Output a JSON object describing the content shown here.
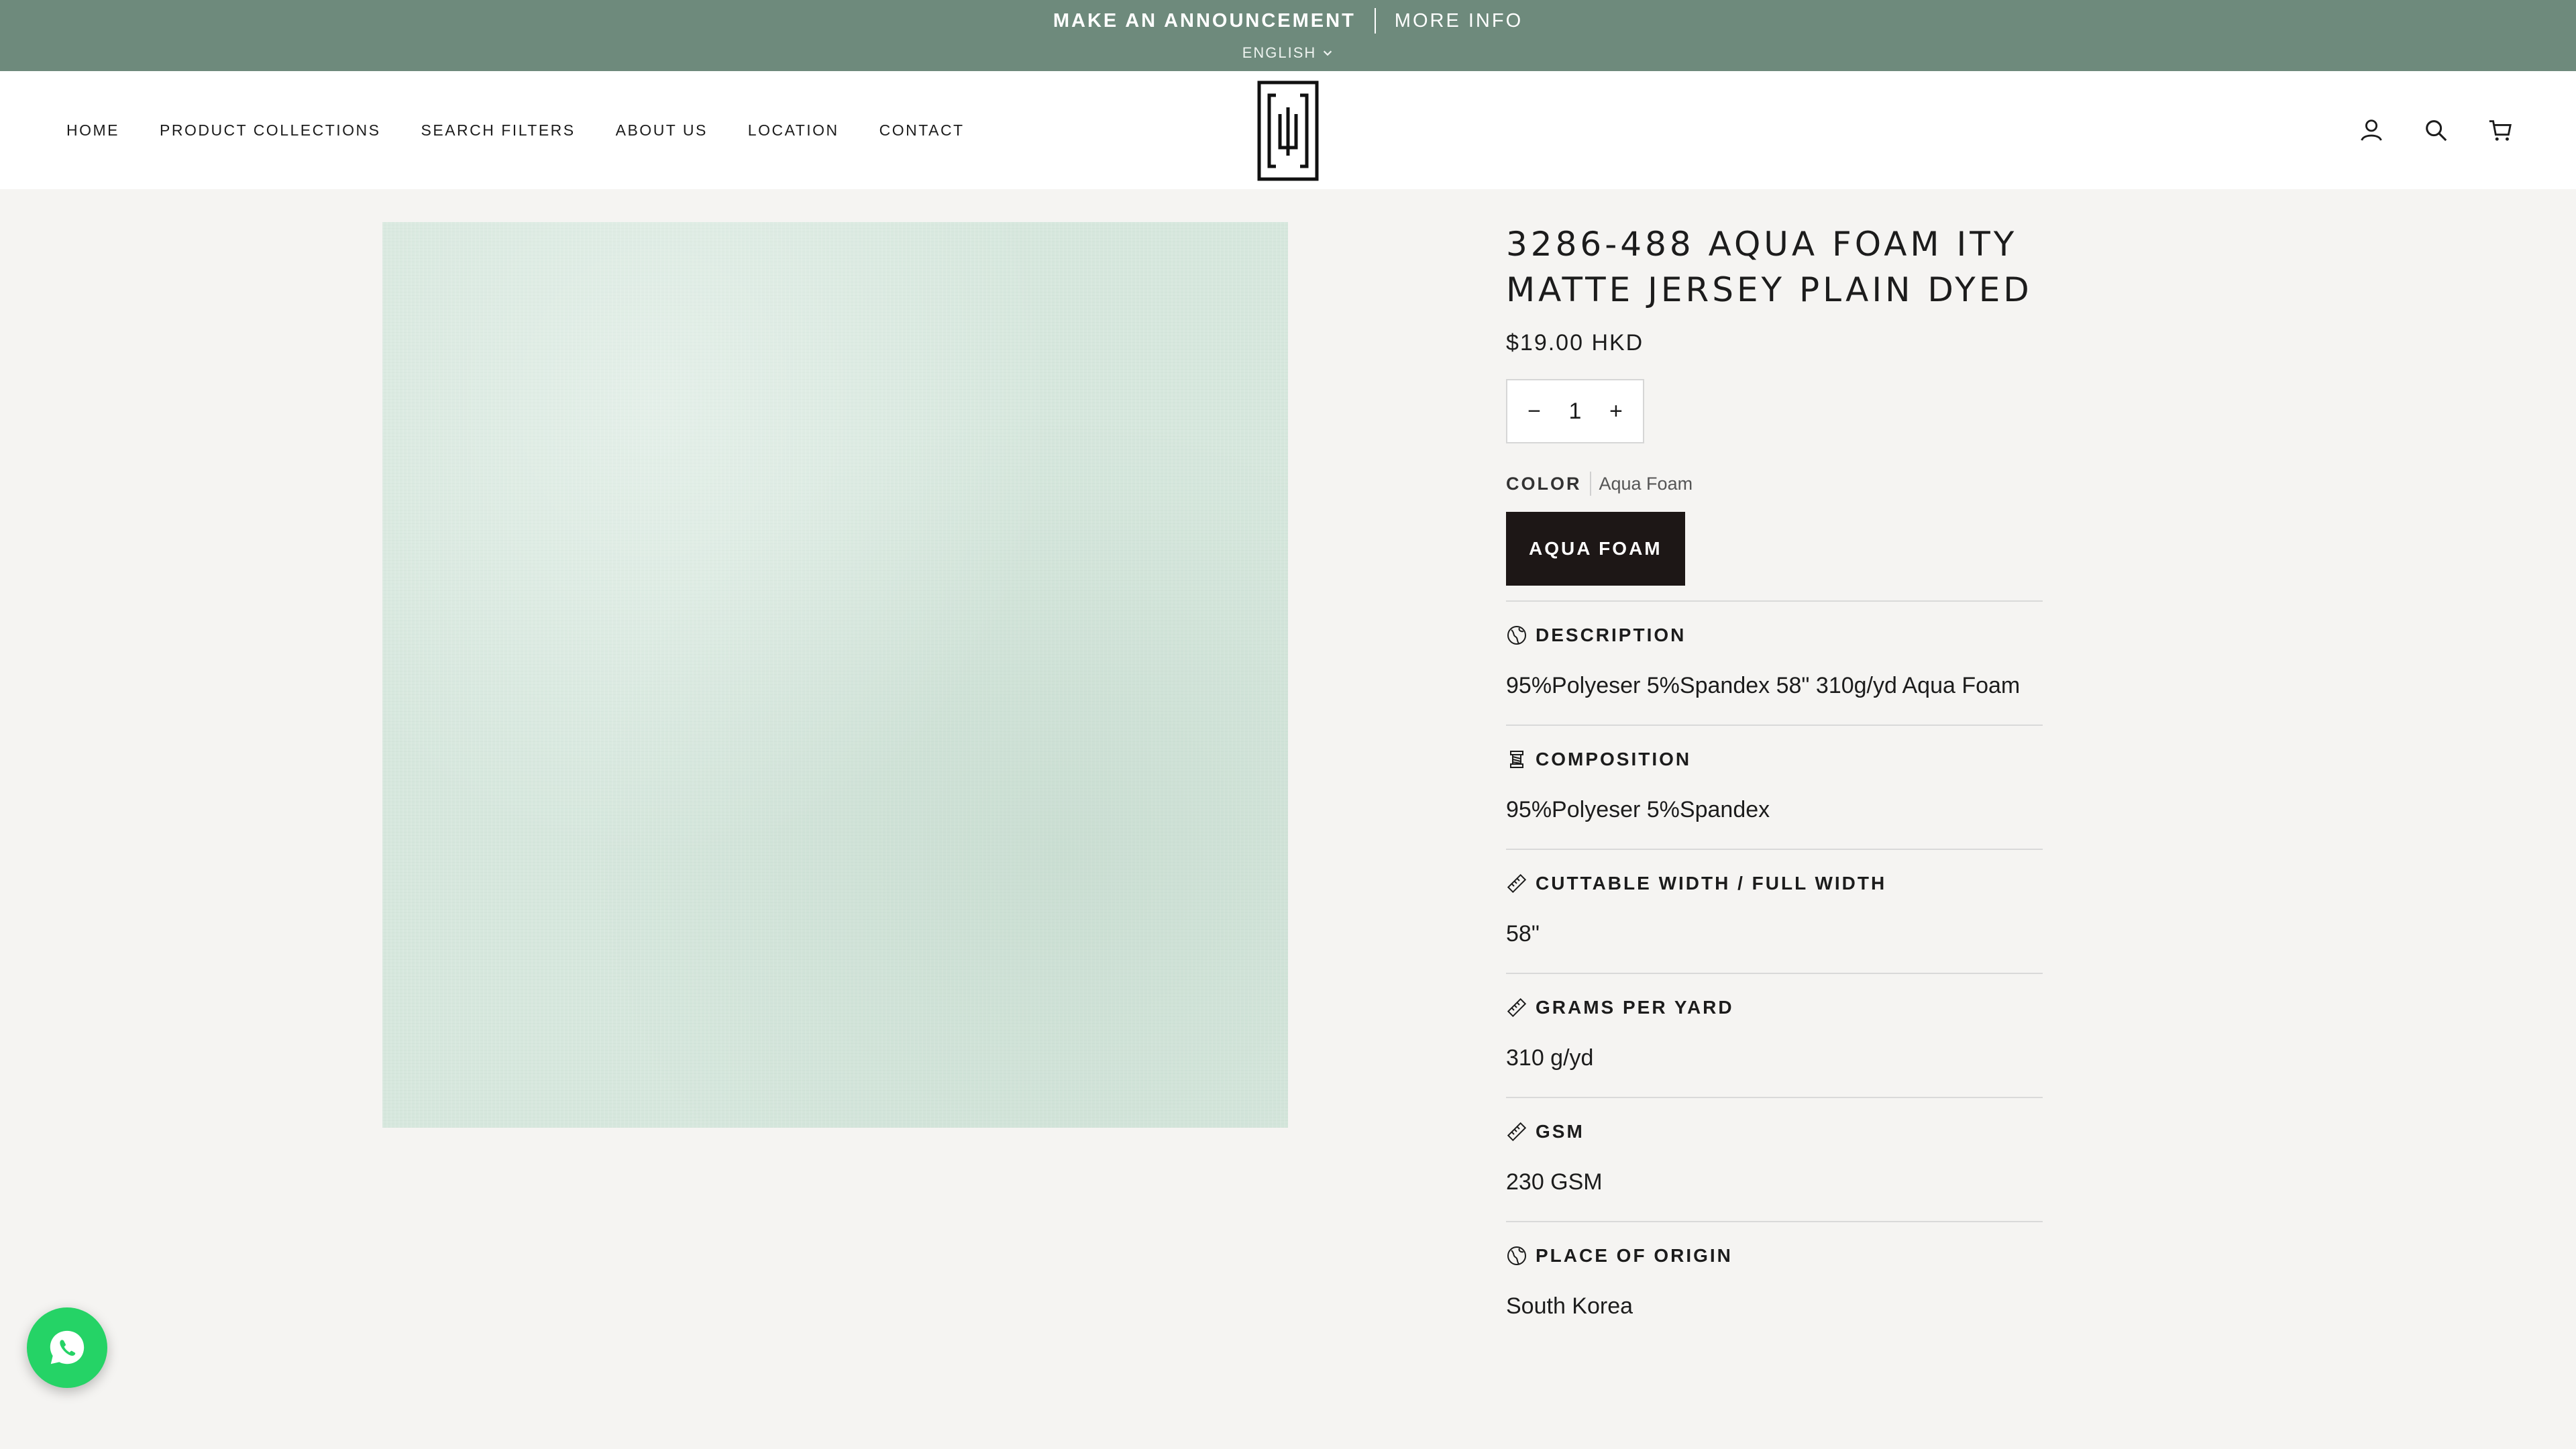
{
  "announcement": {
    "message": "MAKE AN ANNOUNCEMENT",
    "link": "MORE INFO",
    "language": "ENGLISH"
  },
  "nav": {
    "items": [
      "HOME",
      "PRODUCT COLLECTIONS",
      "SEARCH FILTERS",
      "ABOUT US",
      "LOCATION",
      "CONTACT"
    ]
  },
  "header_icons": [
    "account-icon",
    "search-icon",
    "cart-icon"
  ],
  "product": {
    "title": "3286-488 AQUA FOAM ITY MATTE JERSEY PLAIN DYED",
    "price": "$19.00 HKD",
    "quantity": {
      "minus": "−",
      "value": "1",
      "plus": "+"
    },
    "color_label": "COLOR",
    "color_value": "Aqua Foam",
    "swatch_label": "AQUA FOAM",
    "image_color": "#d6e7dd"
  },
  "details": [
    {
      "icon": "globe-icon",
      "heading": "DESCRIPTION",
      "body": "95%Polyeser 5%Spandex 58\" 310g/yd Aqua Foam"
    },
    {
      "icon": "thread-icon",
      "heading": "COMPOSITION",
      "body": "95%Polyeser 5%Spandex"
    },
    {
      "icon": "ruler-icon",
      "heading": "CUTTABLE WIDTH / FULL WIDTH",
      "body": "58\""
    },
    {
      "icon": "ruler-icon",
      "heading": "GRAMS PER YARD",
      "body": "310 g/yd"
    },
    {
      "icon": "ruler-icon",
      "heading": "GSM",
      "body": "230 GSM"
    },
    {
      "icon": "globe-icon",
      "heading": "PLACE OF ORIGIN",
      "body": "South Korea"
    }
  ],
  "colors": {
    "announcement_bg": "#6e8a7c",
    "page_bg": "#f5f4f2",
    "swatch_bg": "#1d1716",
    "whatsapp": "#25d366"
  }
}
